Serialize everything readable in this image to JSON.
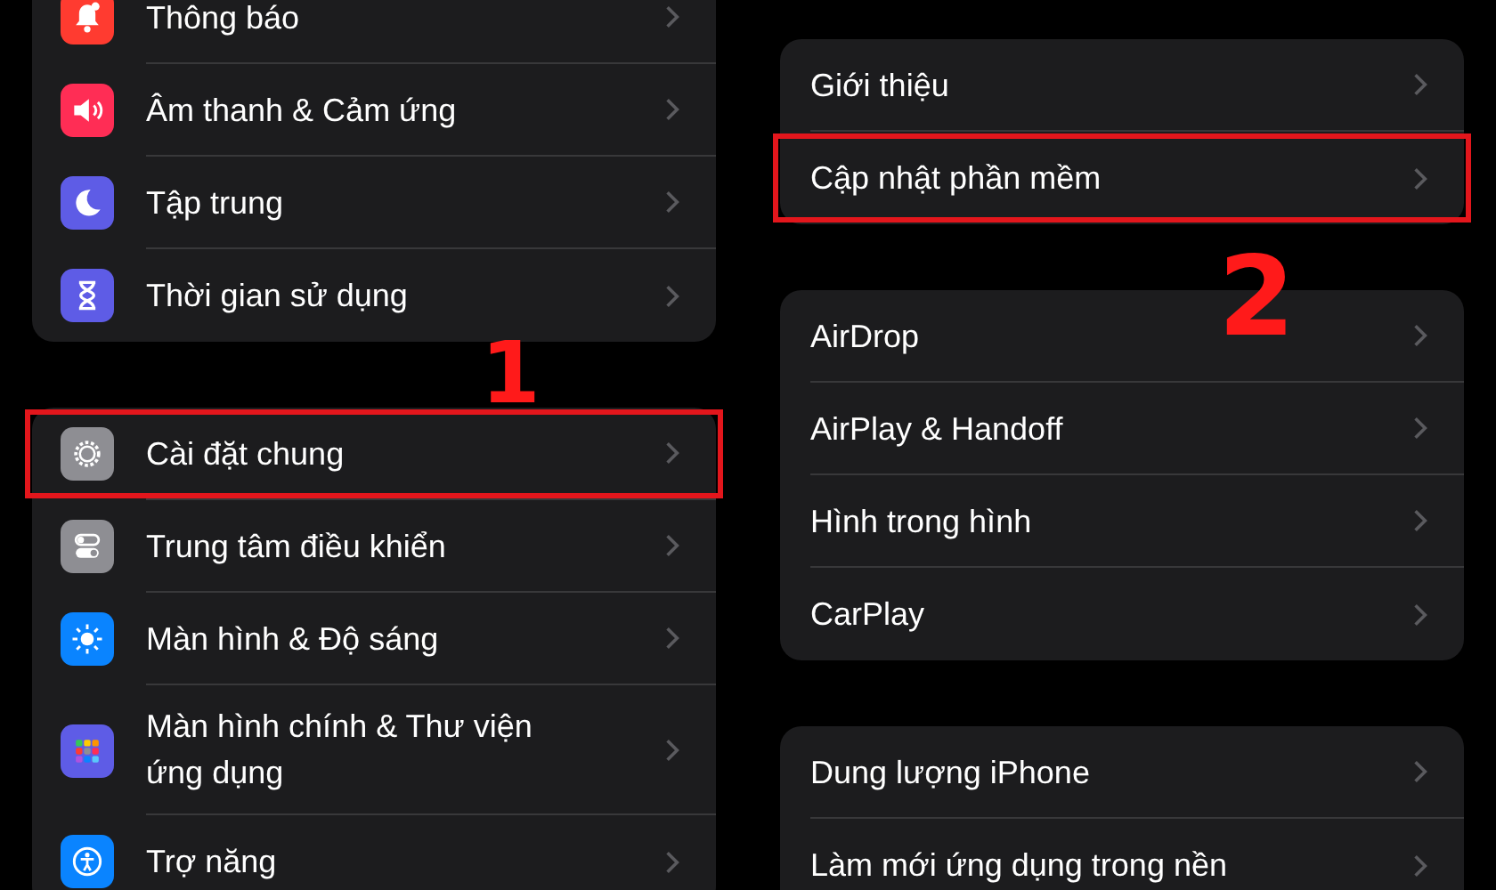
{
  "left_groups": [
    {
      "items": [
        {
          "label": "Thông báo",
          "color": "#ff3b30",
          "highlighted": false
        },
        {
          "label": "Âm thanh & Cảm ứng",
          "color": "#ff2d55",
          "highlighted": false
        },
        {
          "label": "Tập trung",
          "color": "#5e5ce6",
          "highlighted": false
        },
        {
          "label": "Thời gian sử dụng",
          "color": "#5e5ce6",
          "highlighted": false
        }
      ]
    },
    {
      "items": [
        {
          "label": "Cài đặt chung",
          "color": "#8e8e93",
          "highlighted": true
        },
        {
          "label": "Trung tâm điều khiển",
          "color": "#8e8e93",
          "highlighted": false
        },
        {
          "label": "Màn hình & Độ sáng",
          "color": "#0a84ff",
          "highlighted": false
        },
        {
          "label": "Màn hình chính & Thư viện ứng dụng",
          "color": "#5e5ce6",
          "highlighted": false
        },
        {
          "label": "Trợ năng",
          "color": "#0a84ff",
          "highlighted": false
        }
      ]
    }
  ],
  "right_groups": [
    {
      "items": [
        {
          "label": "Giới thiệu",
          "highlighted": false
        },
        {
          "label": "Cập nhật phần mềm",
          "highlighted": true
        }
      ]
    },
    {
      "items": [
        {
          "label": "AirDrop",
          "highlighted": false
        },
        {
          "label": "AirPlay & Handoff",
          "highlighted": false
        },
        {
          "label": "Hình trong hình",
          "highlighted": false
        },
        {
          "label": "CarPlay",
          "highlighted": false
        }
      ]
    },
    {
      "items": [
        {
          "label": "Dung lượng iPhone",
          "highlighted": false
        },
        {
          "label": "Làm mới ứng dụng trong nền",
          "highlighted": false
        }
      ]
    }
  ],
  "annotations": [
    {
      "label": "1"
    },
    {
      "label": "2"
    }
  ]
}
